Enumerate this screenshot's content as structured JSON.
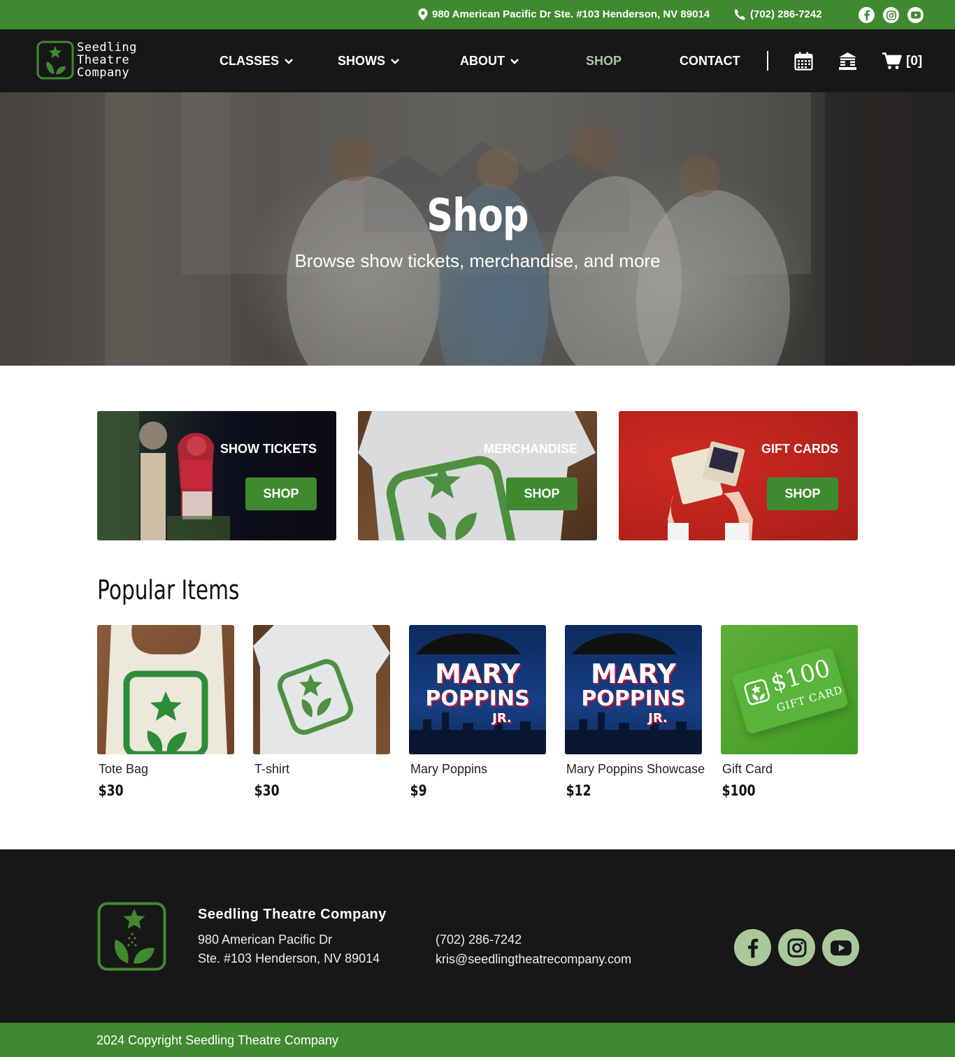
{
  "topbar": {
    "address": "980 American Pacific Dr Ste. #103 Henderson, NV 89014",
    "phone": "(702) 286-7242"
  },
  "brand": {
    "line1": "Seedling",
    "line2": "Theatre",
    "line3": "Company",
    "green": "#3f8a2f",
    "dark": "#171717",
    "light_green": "#a9c99a"
  },
  "nav": {
    "classes": "CLASSES",
    "shows": "SHOWS",
    "about": "ABOUT",
    "shop": "SHOP",
    "contact": "CONTACT",
    "cart_count": "[0]"
  },
  "hero": {
    "title": "Shop",
    "subtitle": "Browse show tickets, merchandise, and more"
  },
  "categories": [
    {
      "title": "SHOW TICKETS",
      "button": "SHOP"
    },
    {
      "title": "MERCHANDISE",
      "button": "SHOP"
    },
    {
      "title": "GIFT CARDS",
      "button": "SHOP"
    }
  ],
  "popular": {
    "title": "Popular Items",
    "items": [
      {
        "name": "Tote Bag",
        "price": "$30"
      },
      {
        "name": "T-shirt",
        "price": "$30"
      },
      {
        "name": "Mary Poppins",
        "price": "$9"
      },
      {
        "name": "Mary Poppins Showcase",
        "price": "$12"
      },
      {
        "name": "Gift Card",
        "price": "$100"
      }
    ],
    "poster_line1": "MARY",
    "poster_line2": "POPPINS",
    "poster_line3": "JR.",
    "giftcard_amount": "$100",
    "giftcard_label": "GIFT CARD"
  },
  "footer": {
    "name": "Seedling Theatre Company",
    "address1": "980 American Pacific Dr",
    "address2": "Ste. #103 Henderson, NV 89014",
    "phone": "(702) 286-7242",
    "email": "kris@seedlingtheatrecompany.com",
    "copyright": "2024 Copyright Seedling Theatre Company"
  }
}
